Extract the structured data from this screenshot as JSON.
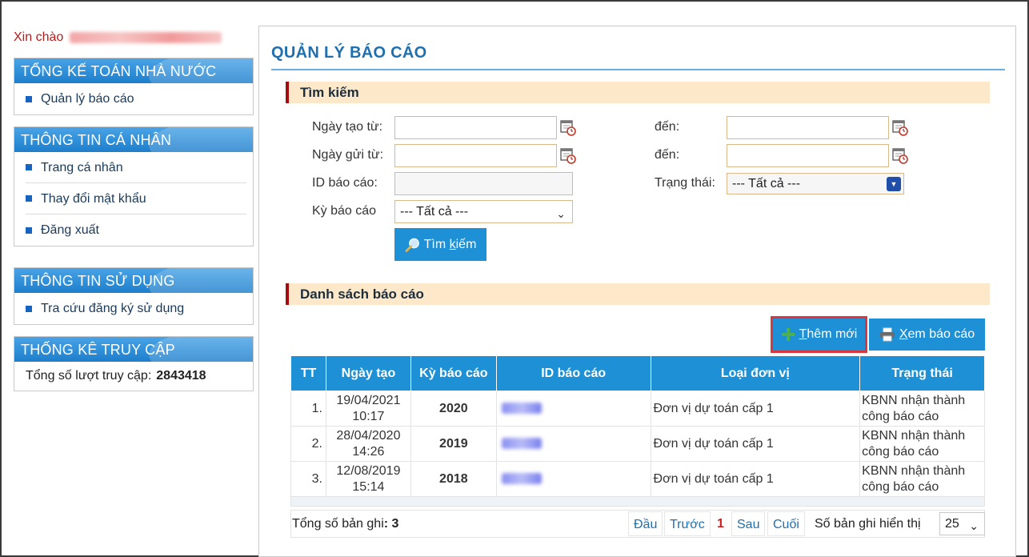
{
  "greeting": {
    "label": "Xin chào"
  },
  "sidebar": {
    "boxes": [
      {
        "title": "TỔNG KẾ TOÁN NHÀ NƯỚC",
        "items": [
          "Quản lý báo cáo"
        ]
      },
      {
        "title": "THÔNG TIN CÁ NHÂN",
        "items": [
          "Trang cá nhân",
          "Thay đổi mật khẩu",
          "Đăng xuất"
        ]
      },
      {
        "title": "THÔNG TIN SỬ DỤNG",
        "items": [
          "Tra cứu đăng ký sử dụng"
        ]
      },
      {
        "title": "THỐNG KÊ TRUY CẬP",
        "stat_label": "Tổng số lượt truy cập:",
        "stat_value": "2843418"
      }
    ]
  },
  "main": {
    "title": "QUẢN LÝ BÁO CÁO",
    "search": {
      "section_title": "Tìm kiếm",
      "created_from_label": "Ngày tạo từ:",
      "created_to_label": "đến:",
      "sent_from_label": "Ngày gửi từ:",
      "sent_to_label": "đến:",
      "report_id_label": "ID báo cáo:",
      "status_label": "Trạng thái:",
      "status_value": "--- Tất cả ---",
      "period_label": "Kỳ báo cáo",
      "period_value": "--- Tất cả ---",
      "search_button_prefix": "Tìm ",
      "search_button_underlined": "k",
      "search_button_suffix": "iếm"
    },
    "list": {
      "section_title": "Danh sách báo cáo",
      "add_button_underlined": "T",
      "add_button_suffix": "hêm mới",
      "view_button_underlined": "X",
      "view_button_suffix": "em báo cáo",
      "columns": [
        "TT",
        "Ngày tạo",
        "Kỳ báo cáo",
        "ID báo cáo",
        "Loại đơn vị",
        "Trạng thái"
      ],
      "rows": [
        {
          "tt": "1.",
          "date": "19/04/2021",
          "time": "10:17",
          "period": "2020",
          "unit_type": "Đơn vị dự toán cấp 1",
          "status_line1": "KBNN nhận thành",
          "status_line2": "công báo cáo"
        },
        {
          "tt": "2.",
          "date": "28/04/2020",
          "time": "14:26",
          "period": "2019",
          "unit_type": "Đơn vị dự toán cấp 1",
          "status_line1": "KBNN nhận thành",
          "status_line2": "công báo cáo"
        },
        {
          "tt": "3.",
          "date": "12/08/2019",
          "time": "15:14",
          "period": "2018",
          "unit_type": "Đơn vị dự toán cấp 1",
          "status_line1": "KBNN nhận thành",
          "status_line2": "công báo cáo"
        }
      ],
      "total_label": "Tổng số bản ghi",
      "total_value": ": 3",
      "pager": {
        "first": "Đầu",
        "prev": "Trước",
        "current": "1",
        "next": "Sau",
        "last": "Cuối"
      },
      "per_page_label": "Số bản ghi hiển thị",
      "per_page_value": "25"
    }
  },
  "colors": {
    "accent_blue": "#1e90d6",
    "title_blue": "#1f6fae",
    "section_bg": "#fde9c9",
    "section_marker": "#a50d0d",
    "highlight_red": "#d9363e",
    "greeting_red": "#b71c1c"
  },
  "icons": {
    "calendar": "calendar-icon",
    "search": "magnifier-icon",
    "add": "green-plus-icon",
    "print": "printer-icon"
  }
}
